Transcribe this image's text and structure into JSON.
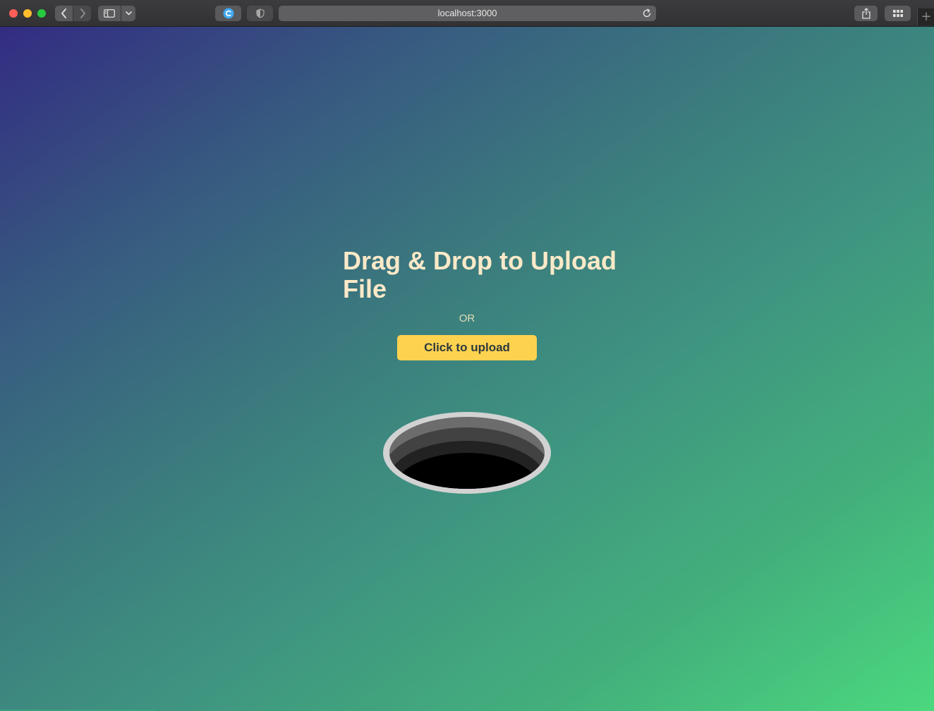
{
  "browser": {
    "url": "localhost:3000",
    "newtab_glyph": "+",
    "icons": [
      "back-arrow-icon",
      "forward-arrow-icon",
      "sidebar-icon",
      "chevron-down-icon",
      "extension-c-icon",
      "shield-icon",
      "reload-icon",
      "share-icon",
      "grid-icon",
      "plus-icon"
    ]
  },
  "page": {
    "title": "Drag & Drop to Upload File",
    "separator": "OR",
    "upload_button": "Click to upload",
    "colors": {
      "gradient_start": "#332c82",
      "gradient_end": "#4bd87e",
      "title": "#fbe9c8",
      "button": "#fdd24f",
      "button_text": "#2f3a3f"
    }
  }
}
